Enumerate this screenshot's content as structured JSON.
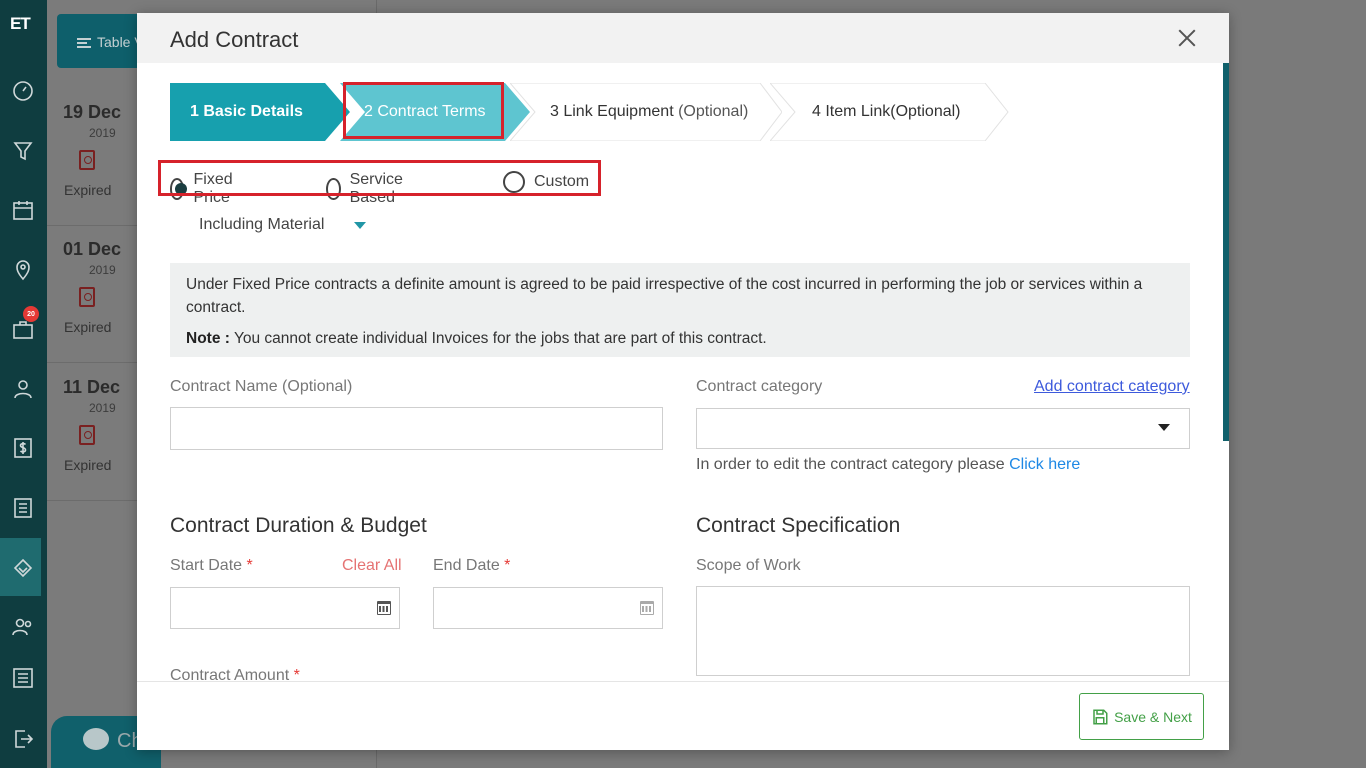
{
  "app": {
    "logo": "ET",
    "nav_badge": "20"
  },
  "background": {
    "table_view_label": "Table V",
    "chat_label": "Ch",
    "list": [
      {
        "day": "19 Dec",
        "year": "2019",
        "status": "Expired"
      },
      {
        "day": "01 Dec",
        "year": "2019",
        "status": "Expired"
      },
      {
        "day": "11 Dec",
        "year": "2019",
        "status": "Expired"
      }
    ]
  },
  "modal": {
    "title": "Add Contract",
    "steps": [
      {
        "label": "1 Basic Details",
        "optional": ""
      },
      {
        "label": "2 Contract Terms",
        "optional": ""
      },
      {
        "label": "3 Link Equipment ",
        "optional": "(Optional)"
      },
      {
        "label": "4 Item Link(Optional)",
        "optional": ""
      }
    ],
    "contract_types": [
      "Fixed Price",
      "Service Based",
      "Custom"
    ],
    "selected_type": "Fixed Price",
    "material_option": "Including Material",
    "info_text": "Under Fixed Price contracts a definite amount is agreed to be paid irrespective of the cost incurred in performing the job or services within a contract.",
    "note_label": "Note :",
    "note_text": " You cannot create individual Invoices for the jobs that are part of this contract.",
    "contract_name_label": "Contract Name (Optional)",
    "contract_name_value": "",
    "category_label": "Contract category",
    "add_category_link": "Add contract category",
    "category_value": "",
    "edit_category_hint": "In order to edit the contract category please ",
    "click_here": "Click here",
    "duration_title": "Contract Duration & Budget",
    "spec_title": "Contract Specification",
    "start_date_label": "Start Date",
    "end_date_label": "End Date",
    "required_mark": "*",
    "clear_all": "Clear All",
    "scope_label": "Scope of Work",
    "amount_label": "Contract Amount",
    "save_next": "Save & Next"
  },
  "colors": {
    "accent": "#1ba0b0",
    "highlight": "#d6222b",
    "save_green": "#43a047",
    "rail": "#0f3d40"
  }
}
